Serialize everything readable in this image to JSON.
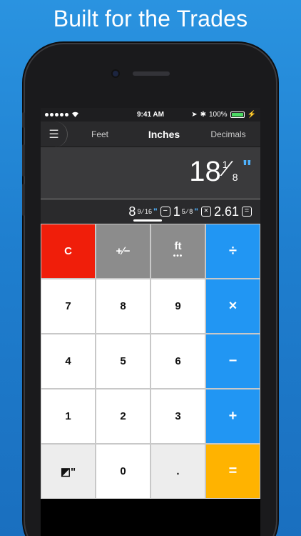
{
  "banner": {
    "title": "Built for the Trades"
  },
  "statusbar": {
    "wifi_icon": "wifi-icon",
    "time": "9:41 AM",
    "battery_percent": "100%",
    "battery_level": 1.0
  },
  "navbar": {
    "menu_icon": "hamburger-icon",
    "tabs": [
      {
        "label": "Feet",
        "active": false
      },
      {
        "label": "Inches",
        "active": true
      },
      {
        "label": "Decimals",
        "active": false
      }
    ]
  },
  "display": {
    "whole": "18",
    "numerator": "1",
    "denominator": "8",
    "unit_mark": "\""
  },
  "history": {
    "a_whole": "8",
    "a_num": "9",
    "a_den": "16",
    "op1": "−",
    "b_whole": "1",
    "b_num": "5",
    "b_den": "8",
    "op2": "×",
    "c": "2.61",
    "op3": "="
  },
  "keypad": {
    "clear": "C",
    "plusminus": "+∕−",
    "ft": "ft",
    "ft_dots": "•••",
    "divide": "÷",
    "seven": "7",
    "eight": "8",
    "nine": "9",
    "multiply": "×",
    "four": "4",
    "five": "5",
    "six": "6",
    "minus": "−",
    "one": "1",
    "two": "2",
    "three": "3",
    "plus": "+",
    "fraction": "◩\"",
    "zero": "0",
    "decimal": ".",
    "equals": "="
  },
  "colors": {
    "clear": "#f01e0a",
    "operator": "#2196f3",
    "equals": "#ffb300",
    "accent": "#4fb3ff"
  }
}
